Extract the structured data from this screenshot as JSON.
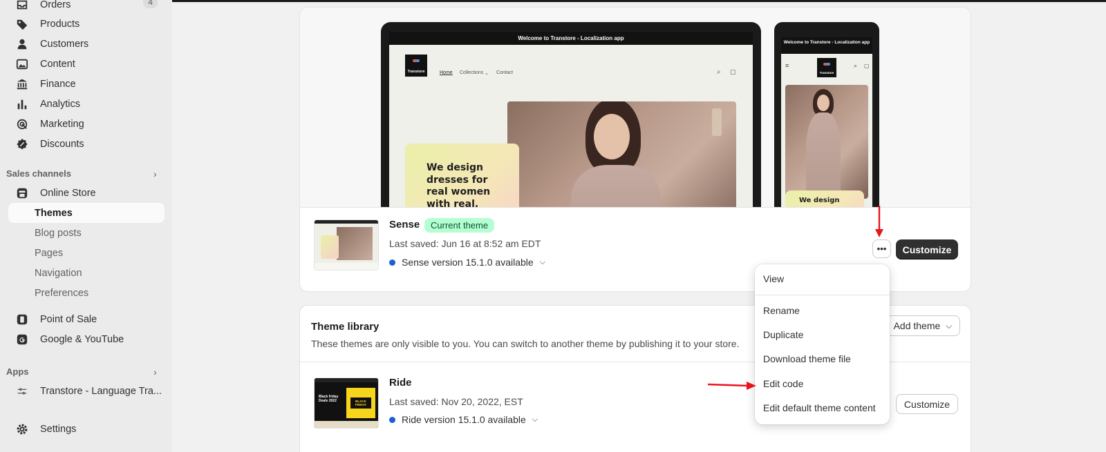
{
  "sidebar": {
    "nav": [
      {
        "label": "Orders",
        "icon": "inbox-icon",
        "count": "4"
      },
      {
        "label": "Products",
        "icon": "tag-icon"
      },
      {
        "label": "Customers",
        "icon": "person-icon"
      },
      {
        "label": "Content",
        "icon": "image-icon"
      },
      {
        "label": "Finance",
        "icon": "bank-icon"
      },
      {
        "label": "Analytics",
        "icon": "bar-chart-icon"
      },
      {
        "label": "Marketing",
        "icon": "target-icon"
      },
      {
        "label": "Discounts",
        "icon": "discount-icon"
      }
    ],
    "sales_channels_label": "Sales channels",
    "online_store": "Online Store",
    "store_sub": [
      "Themes",
      "Blog posts",
      "Pages",
      "Navigation",
      "Preferences"
    ],
    "pos": "Point of Sale",
    "google": "Google & YouTube",
    "apps_label": "Apps",
    "app_item": "Transtore - Language Tra...",
    "settings": "Settings"
  },
  "preview": {
    "announcement": "Welcome to Transtore - Localization app",
    "brand": "Transtore",
    "nav": [
      "Home",
      "Collections",
      "Contact"
    ],
    "promo_lines": [
      "We design",
      "dresses for",
      "real women",
      "with real,"
    ],
    "phone_promo": "We design"
  },
  "current_theme": {
    "name": "Sense",
    "badge": "Current theme",
    "last_saved": "Last saved: Jun 16 at 8:52 am EDT",
    "version": "Sense version 15.1.0 available",
    "more_label": "•••",
    "customize": "Customize"
  },
  "library": {
    "title": "Theme library",
    "description": "These themes are only visible to you. You can switch to another theme by publishing it to your store.",
    "add_theme": "Add theme",
    "themes": [
      {
        "name": "Ride",
        "last_saved": "Last saved: Nov 20, 2022, EST",
        "version": "Ride version 15.1.0 available",
        "customize": "Customize",
        "thumb_text1": "Black friday Deals 2022",
        "thumb_text2": "BLACK FRIDAY"
      }
    ]
  },
  "dropdown": {
    "items": [
      "View",
      "Rename",
      "Duplicate",
      "Download theme file",
      "Edit code",
      "Edit default theme content"
    ]
  },
  "colors": {
    "accent_badge_bg": "#b4fed2",
    "primary_button": "#303030",
    "version_dot": "#1d5fd1",
    "annotation_arrow": "#e8141c"
  }
}
